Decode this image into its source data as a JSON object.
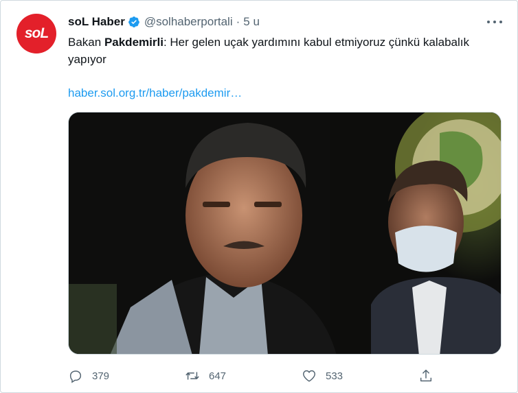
{
  "account": {
    "avatar_text": "soL",
    "name": "soL Haber",
    "handle": "@solhaberportali",
    "separator": "·",
    "time": "5 u"
  },
  "tweet": {
    "text_prefix": "Bakan ",
    "text_bold": "Pakdemirli",
    "text_suffix": ": Her gelen uçak yardımını kabul etmiyoruz çünkü kalabalık yapıyor",
    "link": "haber.sol.org.tr/haber/pakdemir…"
  },
  "media": {
    "alt": "Photo of two men at a night event, one wearing a face mask"
  },
  "actions": {
    "reply_count": "379",
    "retweet_count": "647",
    "like_count": "533"
  },
  "icons": [
    "verified-icon",
    "more-icon",
    "reply-icon",
    "retweet-icon",
    "like-icon",
    "share-icon"
  ],
  "colors": {
    "brand_red": "#e3202a",
    "link_blue": "#1d9bf0",
    "muted": "#536471",
    "verified": "#1d9bf0"
  }
}
